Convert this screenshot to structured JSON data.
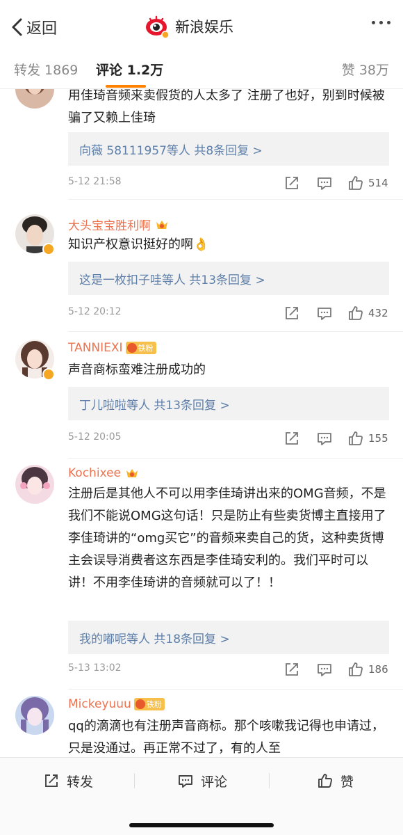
{
  "nav": {
    "back_label": "返回",
    "title": "新浪娱乐",
    "logo_icon": "sina-eye-logo",
    "more_icon": "more-dots-icon"
  },
  "tabs": {
    "repost": "转发 1869",
    "comments": "评论 1.2万",
    "likes": "赞 38万",
    "accent": "#ff8200"
  },
  "comments": [
    {
      "text": "用佳琦音频来卖假货的人太多了 注册了也好，别到时候被骗了又赖上佳琦",
      "replies": "向薇 58111957等人  共8条回复 >",
      "time": "5-12 21:58",
      "likes": "514"
    },
    {
      "user": "大头宝宝胜利啊",
      "text": "知识产权意识挺好的啊👌",
      "replies": "这是一枚扣子哇等人  共13条回复 >",
      "time": "5-12 20:12",
      "likes": "432"
    },
    {
      "user": "TANNIEXI",
      "badge": "铁粉",
      "text": "声音商标蛮难注册成功的",
      "replies": "丁儿啦啦等人  共13条回复 >",
      "time": "5-12 20:05",
      "likes": "155"
    },
    {
      "user": "Kochixee",
      "text": "注册后是其他人不可以用李佳琦讲出来的OMG音频，不是我们不能说OMG这句话！只是防止有些卖货博主直接用了李佳琦讲的“omg买它”的音频来卖自己的货，这种卖货博主会误导消费者这东西是李佳琦安利的。我们平时可以讲！不用李佳琦讲的音频就可以了！！",
      "replies": "我的嘟呢等人  共18条回复 >",
      "time": "5-13 13:02",
      "likes": "186"
    },
    {
      "user": "Mickeyuuu",
      "badge": "铁粉",
      "text": "qq的滴滴也有注册声音商标。那个咳嗽我记得也申请过，只是没通过。再正常不过了，有的人至"
    }
  ],
  "bottom": {
    "repost": "转发",
    "comment": "评论",
    "like": "赞"
  },
  "colors": {
    "username": "#eb7350",
    "reply_link": "#5d7fa9",
    "verified": "#f5a623"
  }
}
